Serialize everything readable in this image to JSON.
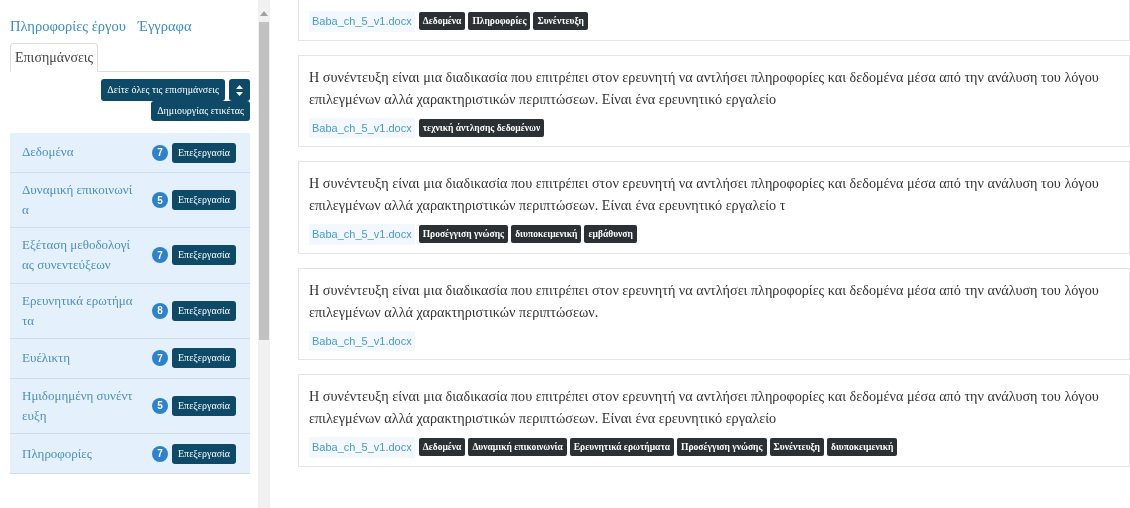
{
  "sidebar": {
    "links": [
      "Πληροφορίες έργου",
      "Έγγραφα"
    ],
    "tabs": [
      {
        "label": "Επισημάνσεις",
        "selected": true
      }
    ],
    "view_all_button": "Δείτε όλες τις επισημάνσεις",
    "create_tag_button": "Δημιουργίας ετικέτας",
    "tags": [
      {
        "label": "Δεδομένα",
        "count": "7",
        "button": "Επεξεργασία"
      },
      {
        "label": "Δυναμική επικοινωνία",
        "count": "5",
        "button": "Επεξεργασία"
      },
      {
        "label": "Εξέταση μεθοδολογίας συνεντεύξεων",
        "count": "7",
        "button": "Επεξεργασία"
      },
      {
        "label": "Ερευνητικά ερωτήματα",
        "count": "8",
        "button": "Επεξεργασία"
      },
      {
        "label": "Ευέλικτη",
        "count": "7",
        "button": "Επεξεργασία"
      },
      {
        "label": "Ημιδομημένη συνέντευξη",
        "count": "5",
        "button": "Επεξεργασία"
      },
      {
        "label": "Πληροφορίες",
        "count": "7",
        "button": "Επεξεργασία"
      }
    ]
  },
  "annotations": [
    {
      "file": "Baba_ch_5_v1.docx",
      "tags": [
        "Δεδομένα",
        "Πληροφορίες",
        "Συνέντευξη"
      ]
    },
    {
      "text": "Η συνέντευξη είναι μια διαδικασία που επιτρέπει στον ερευνητή να αντλήσει πληροφορίες και δεδομένα μέσα από την ανάλυση του λόγου επιλεγμένων αλλά χαρακτηριστικών περιπτώσεων. Είναι ένα ερευνητικό εργαλείο",
      "file": "Baba_ch_5_v1.docx",
      "tags": [
        "τεχνική άντλησης δεδομένων"
      ]
    },
    {
      "text": "Η συνέντευξη είναι μια διαδικασία που επιτρέπει στον ερευνητή να αντλήσει πληροφορίες και δεδομένα μέσα από την ανάλυση του λόγου επιλεγμένων αλλά χαρακτηριστικών περιπτώσεων. Είναι ένα ερευνητικό εργαλείο τ",
      "file": "Baba_ch_5_v1.docx",
      "tags": [
        "Προσέγγιση γνώσης",
        "διυποκειμενική",
        "εμβάθυνση"
      ]
    },
    {
      "text": "Η συνέντευξη είναι μια διαδικασία που επιτρέπει στον ερευνητή να αντλήσει πληροφορίες και δεδομένα μέσα από την ανάλυση του λόγου επιλεγμένων αλλά χαρακτηριστικών περιπτώσεων.",
      "file": "Baba_ch_5_v1.docx"
    },
    {
      "text": "Η συνέντευξη είναι μια διαδικασία που επιτρέπει στον ερευνητή να αντλήσει πληροφορίες και δεδομένα μέσα από την ανάλυση του λόγου επιλεγμένων αλλά χαρακτηριστικών περιπτώσεων. Είναι ένα ερευνητικό εργαλείο",
      "file": "Baba_ch_5_v1.docx",
      "tags": [
        "Δεδομένα",
        "Δυναμική επικοινωνία",
        "Ερευνητικά ερωτήματα",
        "Προσέγγιση γνώσης",
        "Συνέντευξη",
        "διυποκειμενική"
      ]
    }
  ]
}
